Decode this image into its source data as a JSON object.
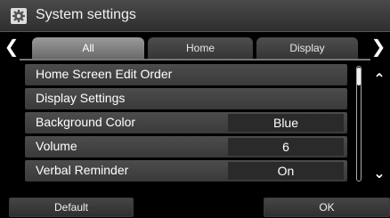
{
  "header": {
    "title": "System settings",
    "icon": "gear-icon"
  },
  "tabs": {
    "items": [
      {
        "label": "All",
        "active": true
      },
      {
        "label": "Home",
        "active": false
      },
      {
        "label": "Display",
        "active": false
      }
    ],
    "prev_icon": "chevron-left-icon",
    "next_icon": "chevron-right-icon"
  },
  "settings": {
    "items": [
      {
        "label": "Home Screen Edit Order",
        "value": ""
      },
      {
        "label": "Display Settings",
        "value": ""
      },
      {
        "label": "Background Color",
        "value": "Blue"
      },
      {
        "label": "Volume",
        "value": "6"
      },
      {
        "label": "Verbal Reminder",
        "value": "On"
      }
    ]
  },
  "scroll": {
    "up_icon": "double-chevron-up-icon",
    "down_icon": "double-chevron-down-icon"
  },
  "footer": {
    "default_label": "Default",
    "ok_label": "OK"
  },
  "colors": {
    "tab_active": "#8a8a8a",
    "row_bg": "#444444",
    "title_bg": "#3c3c3c"
  }
}
